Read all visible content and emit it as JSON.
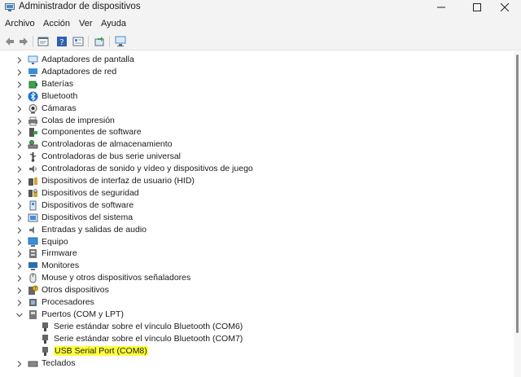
{
  "window": {
    "title": "Administrador de dispositivos"
  },
  "menu": [
    "Archivo",
    "Acción",
    "Ver",
    "Ayuda"
  ],
  "toolbar": [
    "back-arrow-icon",
    "forward-arrow-icon",
    "properties-icon",
    "help-icon",
    "device-list-icon",
    "update-driver-icon",
    "monitor-icon"
  ],
  "tree": {
    "categories": [
      "Adaptadores de pantalla",
      "Adaptadores de red",
      "Baterías",
      "Bluetooth",
      "Cámaras",
      "Colas de impresión",
      "Componentes de software",
      "Controladoras de almacenamiento",
      "Controladoras de bus serie universal",
      "Controladoras de sonido y vídeo y dispositivos de juego",
      "Dispositivos de interfaz de usuario (HID)",
      "Dispositivos de seguridad",
      "Dispositivos de software",
      "Dispositivos del sistema",
      "Entradas y salidas de audio",
      "Equipo",
      "Firmware",
      "Monitores",
      "Mouse y otros dispositivos señaladores",
      "Otros dispositivos",
      "Procesadores"
    ],
    "ports": {
      "label": "Puertos (COM y LPT)",
      "children": [
        "Serie estándar sobre el vínculo Bluetooth (COM6)",
        "Serie estándar sobre el vínculo Bluetooth (COM7)",
        "USB Serial Port (COM8)"
      ],
      "highlighted": "USB Serial Port (COM8)"
    },
    "after": [
      "Teclados"
    ]
  },
  "colors": {
    "highlight": "#ffff3b",
    "icon_blue": "#3b8fd9",
    "chevron": "#555555"
  }
}
